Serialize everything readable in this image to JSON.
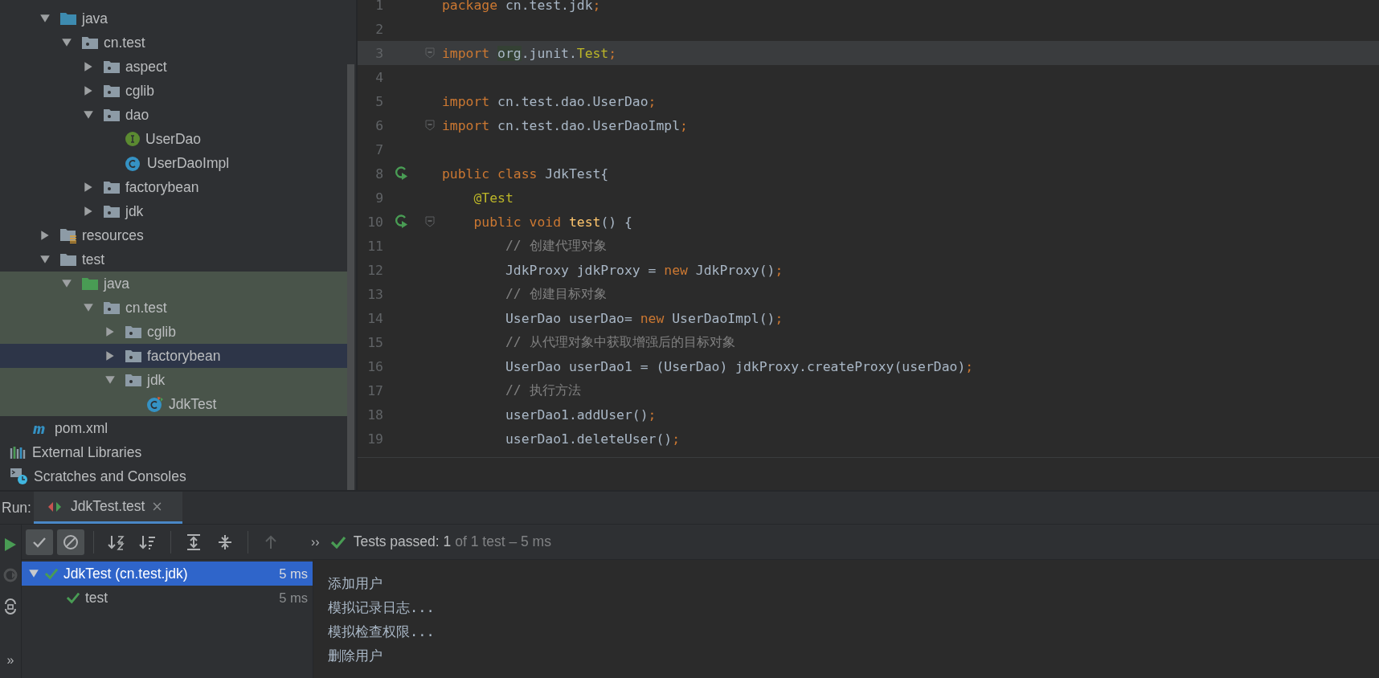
{
  "project_tree": [
    {
      "label": "java",
      "kind": "source-folder",
      "expanded": true,
      "selected": false,
      "highlighted": false,
      "children": [
        {
          "label": "cn.test",
          "kind": "package",
          "expanded": true,
          "selected": false,
          "highlighted": false,
          "children": [
            {
              "label": "aspect",
              "kind": "package",
              "expanded": false,
              "selected": false,
              "highlighted": false
            },
            {
              "label": "cglib",
              "kind": "package",
              "expanded": false,
              "selected": false,
              "highlighted": false
            },
            {
              "label": "dao",
              "kind": "package",
              "expanded": true,
              "selected": false,
              "highlighted": false,
              "children": [
                {
                  "label": "UserDao",
                  "kind": "interface",
                  "selected": false,
                  "highlighted": false
                },
                {
                  "label": "UserDaoImpl",
                  "kind": "class",
                  "selected": false,
                  "highlighted": false
                }
              ]
            },
            {
              "label": "factorybean",
              "kind": "package",
              "expanded": false,
              "selected": false,
              "highlighted": false
            },
            {
              "label": "jdk",
              "kind": "package",
              "expanded": false,
              "selected": false,
              "highlighted": false
            }
          ]
        }
      ]
    },
    {
      "label": "resources",
      "kind": "resources-folder",
      "expanded": false,
      "selected": false,
      "highlighted": false
    },
    {
      "label": "test",
      "kind": "folder",
      "expanded": true,
      "selected": false,
      "highlighted": false,
      "children": [
        {
          "label": "java",
          "kind": "test-folder",
          "expanded": true,
          "selected": false,
          "highlighted": true,
          "children": [
            {
              "label": "cn.test",
              "kind": "package",
              "expanded": true,
              "selected": false,
              "highlighted": true,
              "children": [
                {
                  "label": "cglib",
                  "kind": "package",
                  "expanded": false,
                  "selected": false,
                  "highlighted": true
                },
                {
                  "label": "factorybean",
                  "kind": "package",
                  "expanded": false,
                  "selected": true,
                  "highlighted": true
                },
                {
                  "label": "jdk",
                  "kind": "package",
                  "expanded": true,
                  "selected": false,
                  "highlighted": true,
                  "children": [
                    {
                      "label": "JdkTest",
                      "kind": "test-class",
                      "selected": false,
                      "highlighted": true
                    }
                  ]
                }
              ]
            }
          ]
        }
      ]
    },
    {
      "label": "pom.xml",
      "kind": "maven",
      "selected": false,
      "highlighted": false
    },
    {
      "label": "External Libraries",
      "kind": "libraries",
      "selected": false,
      "highlighted": false
    },
    {
      "label": "Scratches and Consoles",
      "kind": "scratches",
      "selected": false,
      "highlighted": false
    }
  ],
  "editor": {
    "lines": [
      {
        "number": "1",
        "current": false,
        "run": false,
        "fold": false,
        "tokens": [
          {
            "kind": "keyword",
            "text": "package"
          },
          {
            "kind": "plain",
            "text": " cn.test.jdk"
          },
          {
            "kind": "keyword",
            "text": ";"
          }
        ]
      },
      {
        "number": "2",
        "current": false,
        "run": false,
        "fold": false
      },
      {
        "number": "3",
        "current": true,
        "run": false,
        "fold": true,
        "tokens": [
          {
            "kind": "keyword",
            "text": "import "
          },
          {
            "kind": "match",
            "text": "org"
          },
          {
            "kind": "plain",
            "text": ".junit."
          },
          {
            "kind": "annotation",
            "text": "Test"
          },
          {
            "kind": "keyword",
            "text": ";"
          }
        ]
      },
      {
        "number": "4",
        "current": false,
        "run": false,
        "fold": false
      },
      {
        "number": "5",
        "current": false,
        "run": false,
        "fold": false,
        "tokens": [
          {
            "kind": "keyword",
            "text": "import"
          },
          {
            "kind": "plain",
            "text": " cn.test.dao.UserDao"
          },
          {
            "kind": "keyword",
            "text": ";"
          }
        ]
      },
      {
        "number": "6",
        "current": false,
        "run": false,
        "fold": true,
        "tokens": [
          {
            "kind": "keyword",
            "text": "import"
          },
          {
            "kind": "plain",
            "text": " cn.test.dao.UserDaoImpl"
          },
          {
            "kind": "keyword",
            "text": ";"
          }
        ]
      },
      {
        "number": "7",
        "current": false,
        "run": false,
        "fold": false
      },
      {
        "number": "8",
        "current": false,
        "run": true,
        "fold": false,
        "tokens": [
          {
            "kind": "keyword",
            "text": "public class"
          },
          {
            "kind": "plain",
            "text": " JdkTest{"
          }
        ]
      },
      {
        "number": "9",
        "current": false,
        "run": false,
        "fold": false,
        "tokens": [
          {
            "kind": "annotation",
            "text": "    @Test"
          }
        ]
      },
      {
        "number": "10",
        "current": false,
        "run": true,
        "fold": true,
        "tokens": [
          {
            "kind": "keyword",
            "text": "    public void"
          },
          {
            "kind": "method",
            "text": " test"
          },
          {
            "kind": "plain",
            "text": "() {"
          }
        ]
      },
      {
        "number": "11",
        "current": false,
        "run": false,
        "fold": false,
        "tokens": [
          {
            "kind": "comment",
            "text": "        // 创建代理对象"
          }
        ]
      },
      {
        "number": "12",
        "current": false,
        "run": false,
        "fold": false,
        "tokens": [
          {
            "kind": "plain",
            "text": "        JdkProxy jdkProxy = "
          },
          {
            "kind": "keyword",
            "text": "new"
          },
          {
            "kind": "plain",
            "text": " JdkProxy()"
          },
          {
            "kind": "keyword",
            "text": ";"
          }
        ]
      },
      {
        "number": "13",
        "current": false,
        "run": false,
        "fold": false,
        "tokens": [
          {
            "kind": "comment",
            "text": "        // 创建目标对象"
          }
        ]
      },
      {
        "number": "14",
        "current": false,
        "run": false,
        "fold": false,
        "tokens": [
          {
            "kind": "plain",
            "text": "        UserDao userDao= "
          },
          {
            "kind": "keyword",
            "text": "new"
          },
          {
            "kind": "plain",
            "text": " UserDaoImpl()"
          },
          {
            "kind": "keyword",
            "text": ";"
          }
        ]
      },
      {
        "number": "15",
        "current": false,
        "run": false,
        "fold": false,
        "tokens": [
          {
            "kind": "comment",
            "text": "        // 从代理对象中获取增强后的目标对象"
          }
        ]
      },
      {
        "number": "16",
        "current": false,
        "run": false,
        "fold": false,
        "tokens": [
          {
            "kind": "plain",
            "text": "        UserDao userDao1 = (UserDao) jdkProxy.createProxy(userDao)"
          },
          {
            "kind": "keyword",
            "text": ";"
          }
        ]
      },
      {
        "number": "17",
        "current": false,
        "run": false,
        "fold": false,
        "tokens": [
          {
            "kind": "comment",
            "text": "        // 执行方法"
          }
        ]
      },
      {
        "number": "18",
        "current": false,
        "run": false,
        "fold": false,
        "tokens": [
          {
            "kind": "plain",
            "text": "        userDao1.addUser()"
          },
          {
            "kind": "keyword",
            "text": ";"
          }
        ]
      },
      {
        "number": "19",
        "current": false,
        "run": false,
        "fold": false,
        "tokens": [
          {
            "kind": "plain",
            "text": "        userDao1.deleteUser()"
          },
          {
            "kind": "keyword",
            "text": ";"
          }
        ]
      }
    ]
  },
  "run_panel": {
    "label": "Run:",
    "tab": {
      "title": "JdkTest.test",
      "selected": true
    },
    "side_tools": [
      {
        "kind": "run",
        "disabled": false
      },
      {
        "kind": "rerun-failed",
        "disabled": true
      },
      {
        "kind": "toggle-auto",
        "disabled": false
      },
      {
        "kind": "more",
        "text": "»",
        "disabled": false
      }
    ],
    "tools": [
      {
        "kind": "show-passed",
        "on": true,
        "disabled": false
      },
      {
        "kind": "show-ignored",
        "on": true,
        "disabled": false
      },
      {
        "kind": "sort-alpha",
        "on": false,
        "disabled": false
      },
      {
        "kind": "sort-duration",
        "on": false,
        "disabled": false
      },
      {
        "kind": "expand-all",
        "on": false,
        "disabled": false
      },
      {
        "kind": "collapse-all",
        "on": false,
        "disabled": false
      },
      {
        "kind": "previous",
        "on": false,
        "disabled": true
      }
    ],
    "more": "››",
    "status": {
      "main": "Tests passed: 1",
      "detail": "of 1 test – 5 ms"
    },
    "results": [
      {
        "name": "JdkTest (cn.test.jdk)",
        "time": "5 ms",
        "selected": true,
        "expanded": true,
        "children": [
          {
            "name": "test",
            "time": "5 ms",
            "selected": false
          }
        ]
      }
    ],
    "console": [
      "添加用户",
      "模拟记录日志...",
      "模拟检查权限...",
      "删除用户"
    ]
  }
}
